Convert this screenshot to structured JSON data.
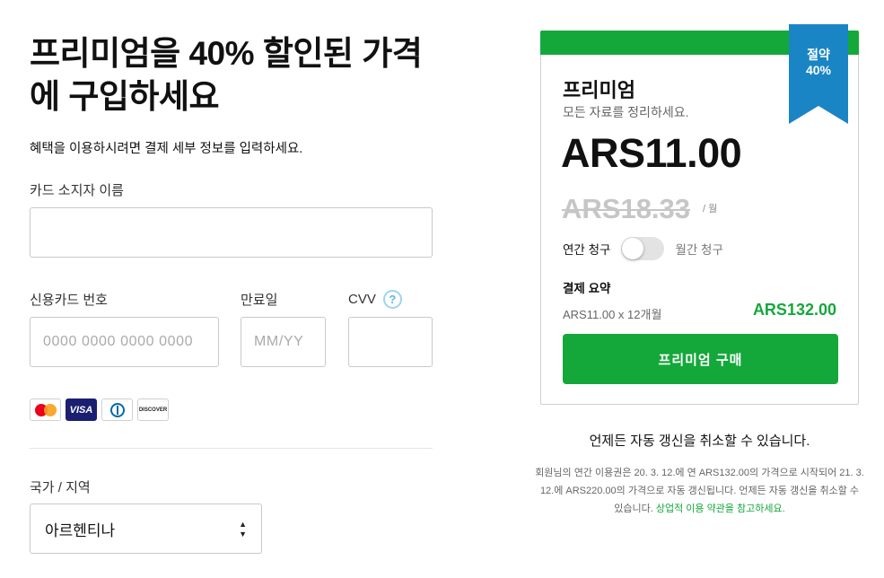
{
  "left": {
    "headline": "프리미엄을 40% 할인된 가격에 구입하세요",
    "subtext": "혜택을 이용하시려면 결제 세부 정보를 입력하세요.",
    "cardholder_label": "카드 소지자 이름",
    "cardholder_value": "",
    "card_number_label": "신용카드 번호",
    "card_number_placeholder": "0000 0000 0000 0000",
    "expiry_label": "만료일",
    "expiry_placeholder": "MM/YY",
    "cvv_label": "CVV",
    "cvv_help": "?",
    "card_brands": {
      "mastercard": "mastercard-icon",
      "visa": "VISA",
      "diners": "diners-club-icon",
      "discover": "DISCOVER"
    },
    "country_label": "국가 / 지역",
    "country_value": "아르헨티나"
  },
  "card": {
    "ribbon_line1": "절약",
    "ribbon_line2": "40%",
    "plan_name": "프리미엄",
    "plan_desc": "모든 자료를 정리하세요.",
    "price": "ARS11.00",
    "old_price": "ARS18.33",
    "per": "/ 월",
    "billing_annual": "연간 청구",
    "billing_monthly": "월간 청구",
    "toggle_on": false,
    "summary_title": "결제 요약",
    "summary_detail": "ARS11.00 x 12개월",
    "summary_total": "ARS132.00",
    "buy_button": "프리미엄 구매"
  },
  "footer": {
    "cancel_note": "언제든 자동 갱신을 취소할 수 있습니다.",
    "fine_print": "회원님의 연간 이용권은 20. 3. 12.에 연 ARS132.00의 가격으로 시작되어 21. 3. 12.에 ARS220.00의 가격으로 자동 갱신됩니다. 언제든 자동 갱신을 취소할 수 있습니다. ",
    "terms_link": "상업적 이용 약관을 참고하세요."
  },
  "colors": {
    "accent_green": "#14a83b",
    "ribbon_blue": "#1a85c5",
    "help_blue": "#5bb7e6"
  }
}
